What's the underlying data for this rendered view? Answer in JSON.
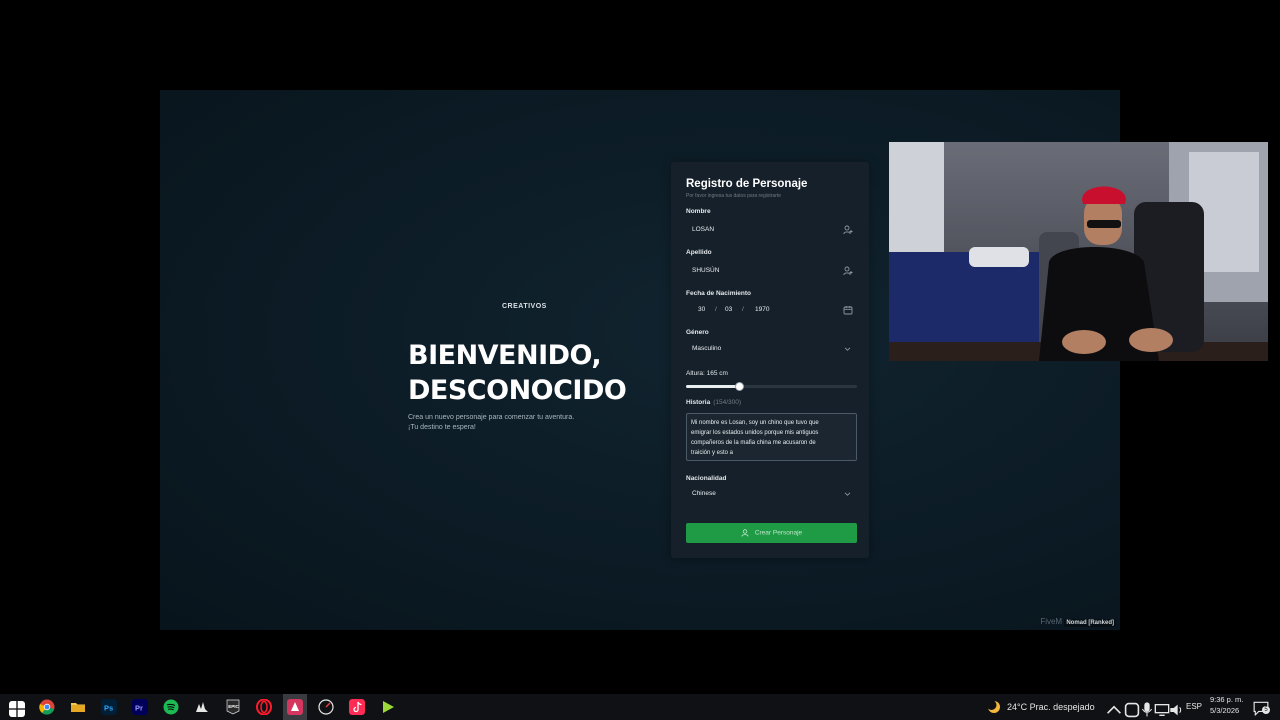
{
  "hero": {
    "logo": "CREATIVOS",
    "line1": "BIENVENIDO,",
    "line2": "DESCONOCIDO",
    "sub1": "Crea un nuevo personaje para comenzar tu aventura.",
    "sub2": "¡Tu destino te espera!"
  },
  "form": {
    "title": "Registro de Personaje",
    "subtitle": "Por favor ingresa tus datos para registrarte",
    "nombre_label": "Nombre",
    "nombre_value": "LOSAN",
    "apellido_label": "Apellido",
    "apellido_value": "SHUSÚN",
    "fecha_label": "Fecha de Nacimiento",
    "fecha_day": "30",
    "fecha_month": "03",
    "fecha_year": "1970",
    "fecha_sep": "/",
    "genero_label": "Género",
    "genero_value": "Masculino",
    "altura_label": "Altura: 165 cm",
    "altura_fraction": 0.31,
    "historia_label": "Historia",
    "historia_count": "(154/300)",
    "historia_lines": [
      "Mi nombre es Losan, soy un chino que tuvo que",
      "emigrar los estados unidos porque mis antiguos",
      "compañeros de la mafia china me acusaron de",
      "traición y esto a"
    ],
    "nacionalidad_label": "Nacionalidad",
    "nacionalidad_value": "Chinese",
    "create_label": "Crear Personaje"
  },
  "watermark": {
    "text": "FiveM",
    "badge": "Nomad [Ranked]"
  },
  "taskbar": {
    "weather": "24°C  Prac. despejado",
    "lang": "ESP",
    "time": "9:36 p. m.",
    "date": "5/3/2026",
    "notif_count": "5",
    "apps": [
      "windows-start",
      "chrome",
      "file-explorer",
      "photoshop",
      "premiere",
      "spotify",
      "audio-app",
      "epic-games",
      "opera",
      "game-app",
      "speedometer-app",
      "tiktok",
      "media-app"
    ]
  },
  "colors": {
    "accent_green": "#1f9a45",
    "panel_bg": "#16202a",
    "game_bg": "#0c1b25"
  }
}
